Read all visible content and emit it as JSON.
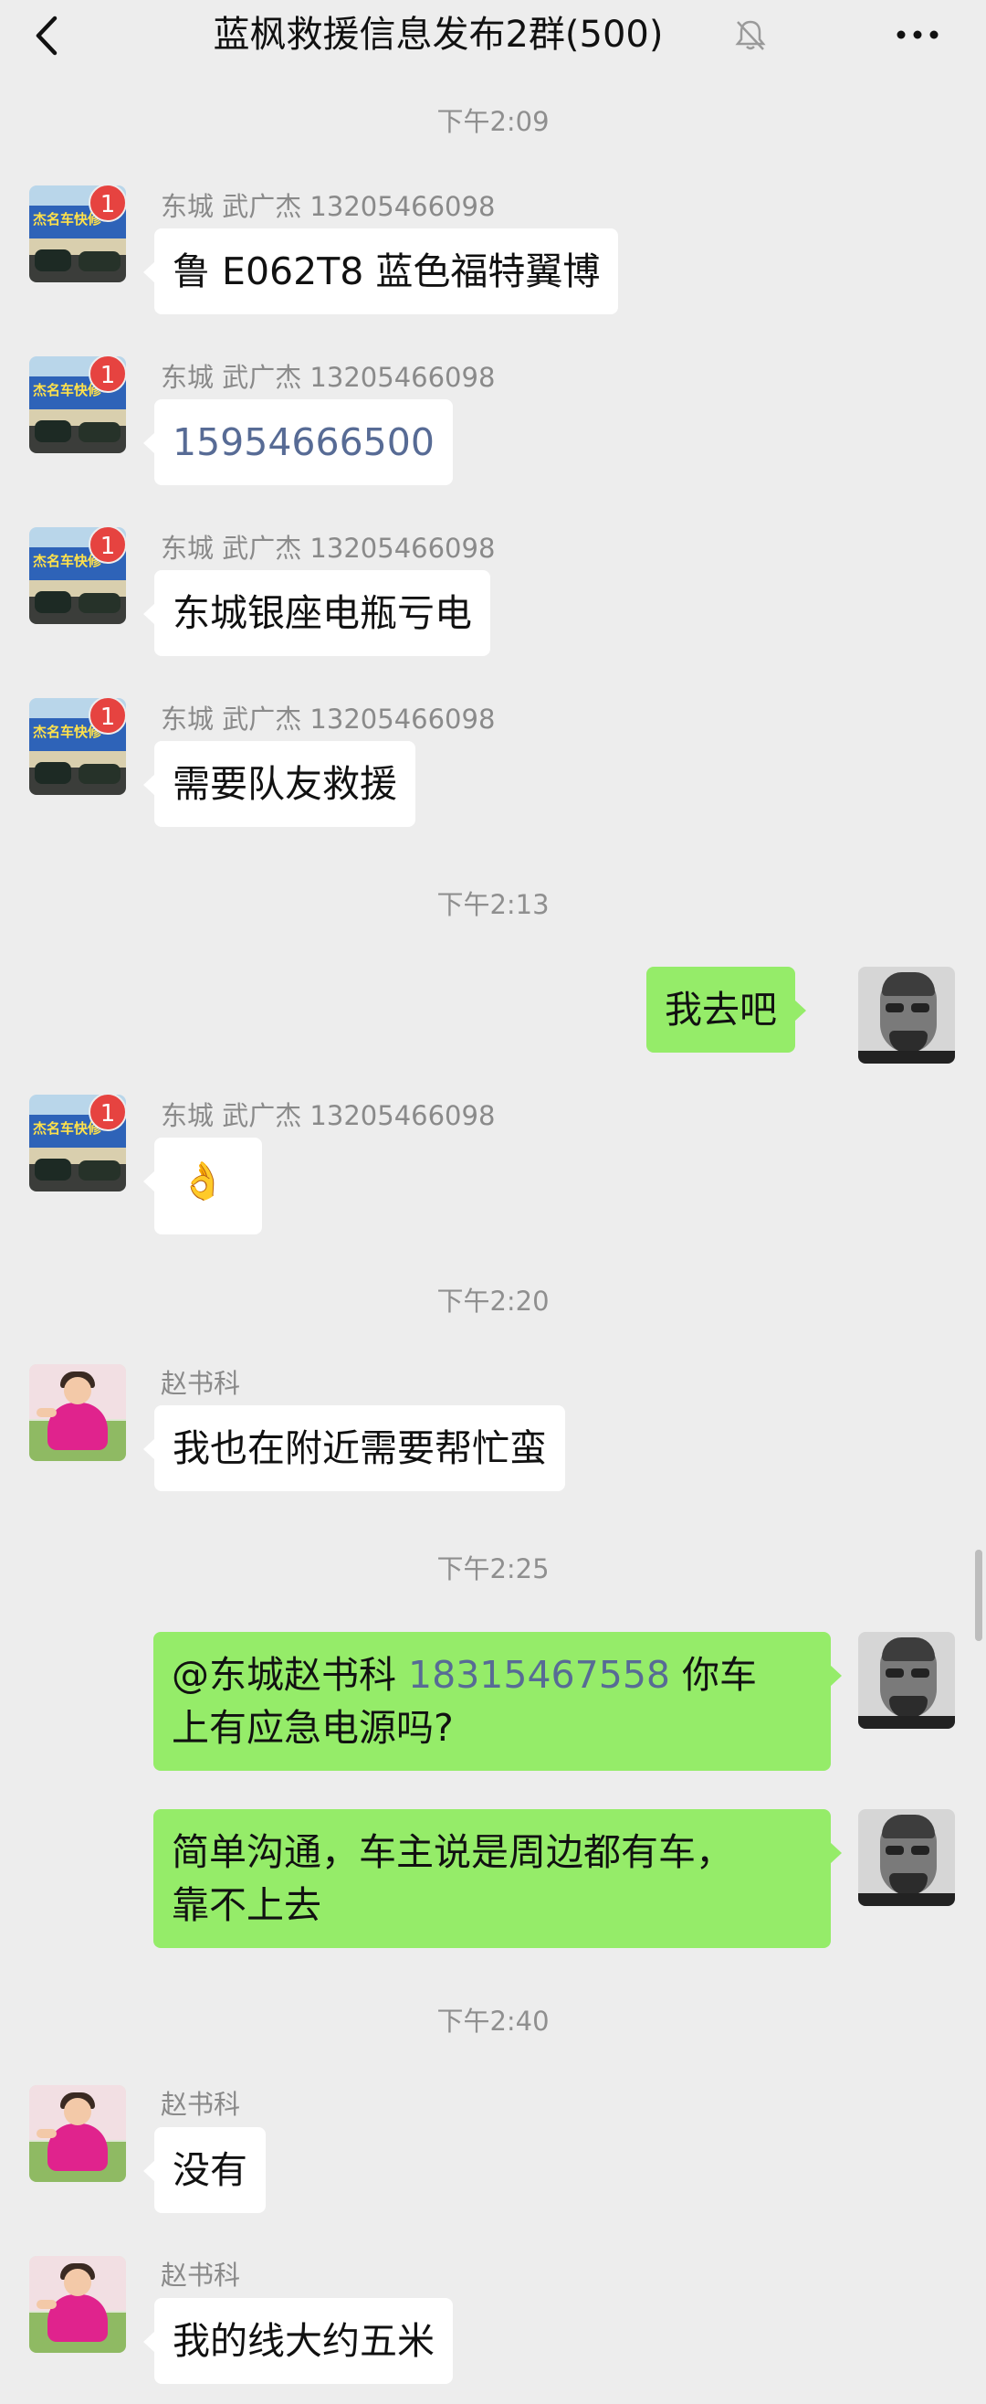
{
  "header": {
    "title": "蓝枫救援信息发布2群(500)"
  },
  "times": [
    "下午2:09",
    "下午2:13",
    "下午2:20",
    "下午2:25",
    "下午2:40"
  ],
  "shop_avatar_sign": "杰名车快修",
  "badge_count": "1",
  "messages": [
    {
      "sender": "东城 武广杰 13205466098",
      "text": "鲁 E062T8 蓝色福特翼博"
    },
    {
      "sender": "东城 武广杰 13205466098",
      "text": "15954666500"
    },
    {
      "sender": "东城 武广杰 13205466098",
      "text": "东城银座电瓶亏电"
    },
    {
      "sender": "东城 武广杰 13205466098",
      "text": "需要队友救援"
    },
    {
      "sender": "",
      "text": "我去吧"
    },
    {
      "sender": "东城 武广杰 13205466098",
      "text": "👌"
    },
    {
      "sender": "赵书科",
      "text": "我也在附近需要帮忙蛮"
    },
    {
      "sender": "",
      "text_a": "@东城赵书科",
      "text_link": "18315467558",
      "text_b": "你车",
      "text_c": "上有应急电源吗?"
    },
    {
      "sender": "",
      "text_a": "简单沟通，车主说是周边都有车，",
      "text_b": "靠不上去"
    },
    {
      "sender": "赵书科",
      "text": "没有"
    },
    {
      "sender": "赵书科",
      "text": "我的线大约五米"
    }
  ]
}
